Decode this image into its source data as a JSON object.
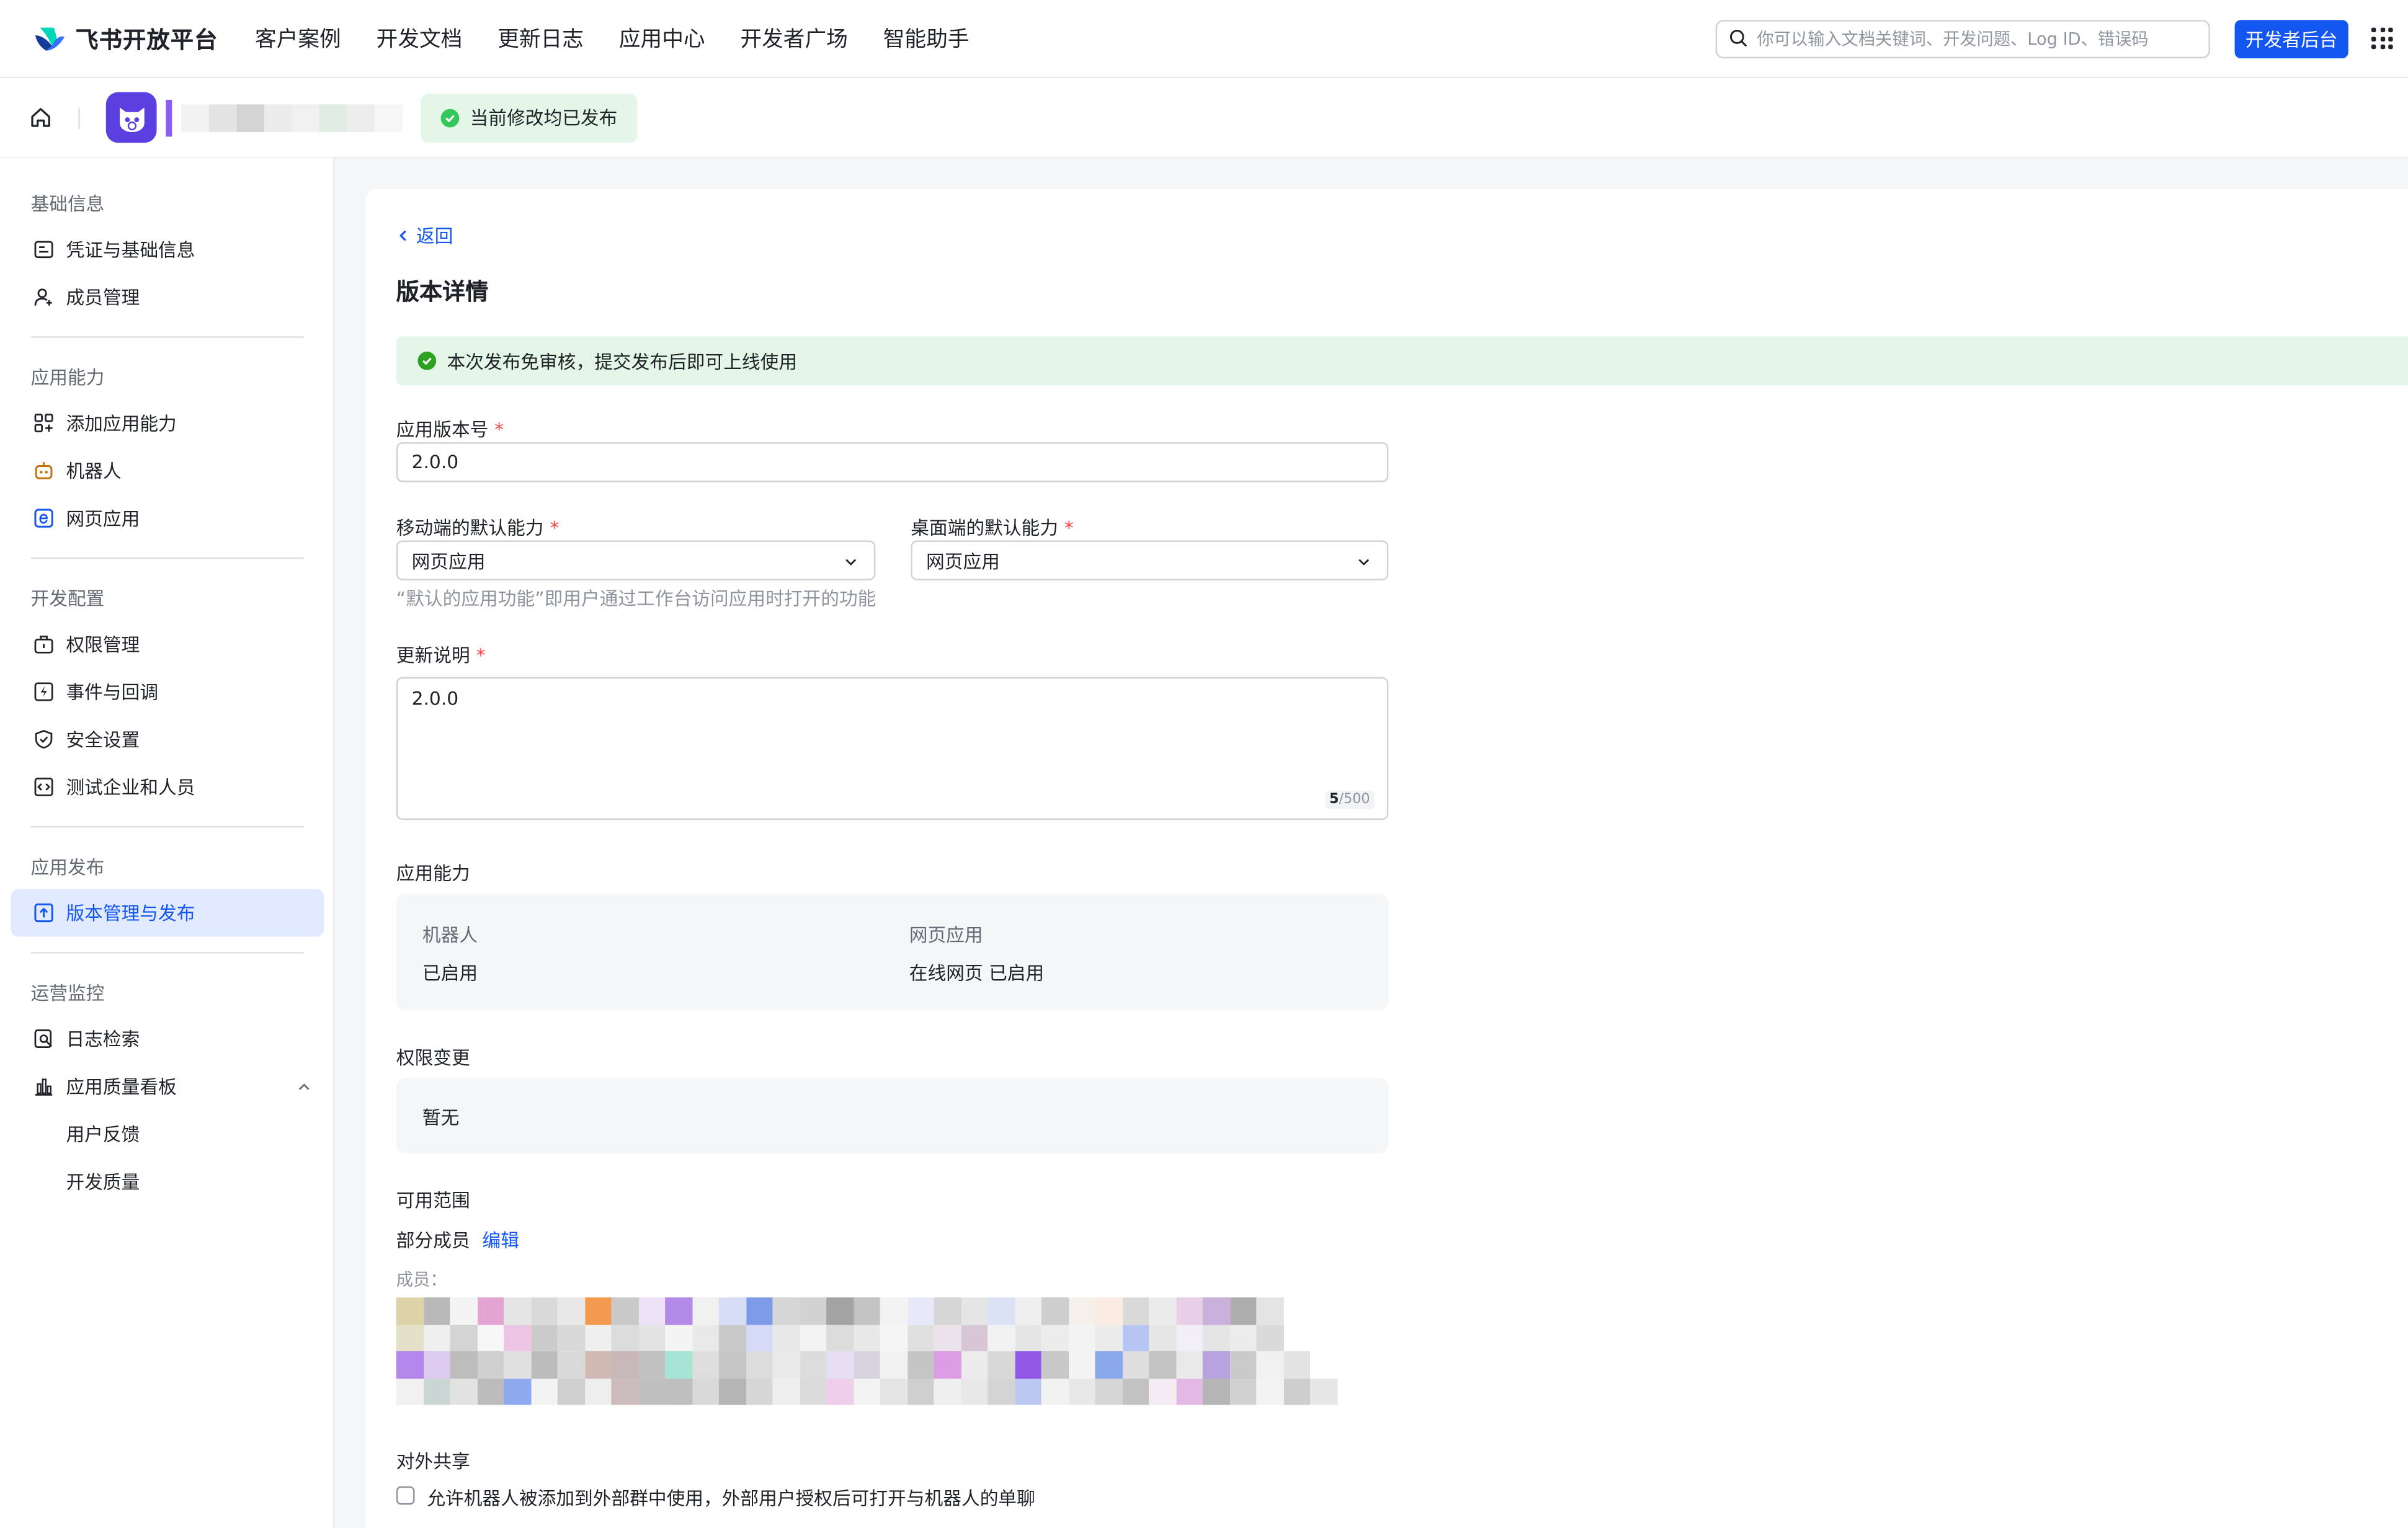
{
  "topnav": {
    "brand": "飞书开放平台",
    "items": [
      "客户案例",
      "开发文档",
      "更新日志",
      "应用中心",
      "开发者广场",
      "智能助手"
    ],
    "search_placeholder": "你可以输入文档关键词、开发问题、Log ID、错误码",
    "dev_console": "开发者后台"
  },
  "subbar": {
    "status": "当前修改均已发布"
  },
  "sidebar": {
    "sections": [
      {
        "title": "基础信息",
        "items": [
          "凭证与基础信息",
          "成员管理"
        ]
      },
      {
        "title": "应用能力",
        "items": [
          "添加应用能力",
          "机器人",
          "网页应用"
        ]
      },
      {
        "title": "开发配置",
        "items": [
          "权限管理",
          "事件与回调",
          "安全设置",
          "测试企业和人员"
        ]
      },
      {
        "title": "应用发布",
        "items": [
          "版本管理与发布"
        ]
      },
      {
        "title": "运营监控",
        "items": [
          "日志检索",
          "应用质量看板"
        ],
        "subitems": [
          "用户反馈",
          "开发质量"
        ]
      }
    ]
  },
  "main": {
    "back": "返回",
    "title": "版本详情",
    "banner": "本次发布免审核，提交发布后即可上线使用",
    "version_label": "应用版本号",
    "version_value": "2.0.0",
    "mobile_label": "移动端的默认能力",
    "mobile_value": "网页应用",
    "desktop_label": "桌面端的默认能力",
    "desktop_value": "网页应用",
    "default_hint": "“默认的应用功能”即用户通过工作台访问应用时打开的功能",
    "notes_label": "更新说明",
    "notes_value": "2.0.0",
    "notes_count": "5",
    "notes_max": "/500",
    "capability_label": "应用能力",
    "capabilities": [
      {
        "name": "机器人",
        "status": "已启用"
      },
      {
        "name": "网页应用",
        "status": "在线网页 已启用"
      }
    ],
    "permission_label": "权限变更",
    "permission_value": "暂无",
    "scope_label": "可用范围",
    "scope_value": "部分成员",
    "scope_edit": "编辑",
    "members_label": "成员：",
    "share_label": "对外共享",
    "share_checkbox": "允许机器人被添加到外部群中使用，外部用户授权后可打开与机器人的单聊"
  },
  "colors": {
    "accent": "#1456f0",
    "success_bg": "#e4f6e8",
    "success": "#34c759",
    "required": "#f54a45"
  }
}
